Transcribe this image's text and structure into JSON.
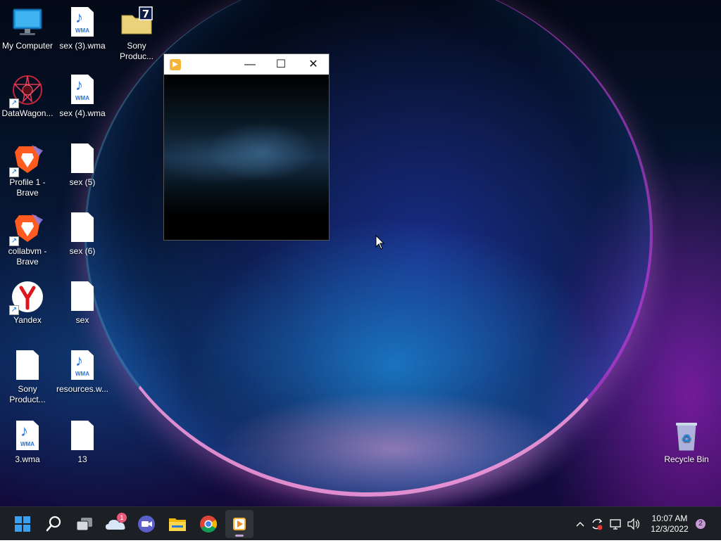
{
  "desktop": {
    "icons": [
      {
        "label": "My Computer"
      },
      {
        "label": "sex (3).wma"
      },
      {
        "label": "Sony Produc..."
      },
      {
        "label": "DataWagon..."
      },
      {
        "label": "sex (4).wma"
      },
      {
        "label": "Profile 1 - Brave"
      },
      {
        "label": "sex (5)"
      },
      {
        "label": "collabvm - Brave"
      },
      {
        "label": "sex (6)"
      },
      {
        "label": "Yandex"
      },
      {
        "label": "sex"
      },
      {
        "label": "Sony Product..."
      },
      {
        "label": "resources.w..."
      },
      {
        "label": "3.wma"
      },
      {
        "label": "13"
      },
      {
        "label": "Recycle Bin"
      }
    ],
    "wma_tag": "WMA",
    "archive_tag": "7"
  },
  "window": {
    "minimize_glyph": "—",
    "maximize_glyph": "☐",
    "close_glyph": "✕",
    "app_icon": "media-player-icon"
  },
  "taskbar": {
    "onedrive_badge": "1",
    "clock_time": "10:07 AM",
    "clock_date": "12/3/2022",
    "notification_count": "2",
    "icons": [
      "start-icon",
      "search-icon",
      "task-view-icon",
      "onedrive-icon",
      "meet-icon",
      "file-explorer-icon",
      "chrome-icon",
      "media-player-icon"
    ]
  },
  "colors": {
    "taskbar_bg": "#1c1f24",
    "accent_blue": "#2a73d6",
    "window_title_bg": "#ffffff"
  }
}
